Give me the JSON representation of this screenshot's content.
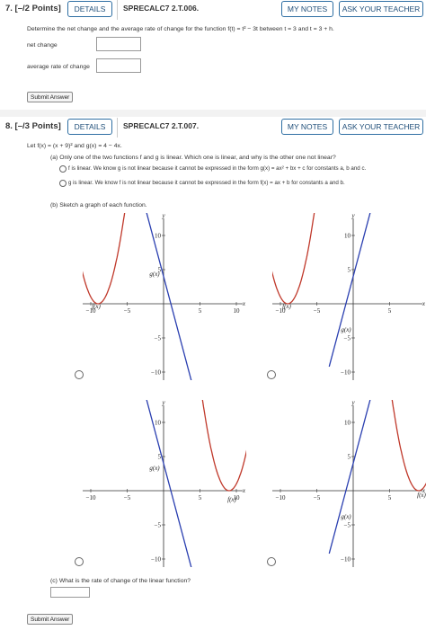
{
  "q7": {
    "number": "7. [–/2 Points]",
    "details": "DETAILS",
    "code": "SPRECALC7 2.T.006.",
    "my_notes": "MY NOTES",
    "ask": "ASK YOUR TEACHER",
    "prompt": "Determine the net change and the average rate of change for the function f(t) = t² − 3t between t = 3 and t = 3 + h.",
    "net_change_label": "net change",
    "avg_rate_label": "average rate of change",
    "submit": "Submit Answer"
  },
  "q8": {
    "number": "8. [–/3 Points]",
    "details": "DETAILS",
    "code": "SPRECALC7 2.T.007.",
    "my_notes": "MY NOTES",
    "ask": "ASK YOUR TEACHER",
    "let": "Let f(x) = (x + 9)² and g(x) = 4 − 4x.",
    "part_a": "(a) Only one of the two functions f and g is linear. Which one is linear, and why is the other one not linear?",
    "option1": "f is linear. We know g is not linear because it cannot be expressed in the form g(x) = ax² + bx + c for constants a, b and c.",
    "option2": "g is linear. We know f is not linear because it cannot be expressed in the form f(x) = ax + b for constants a and b.",
    "part_b": "(b) Sketch a graph of each function.",
    "part_c": "(c) What is the rate of change of the linear function?",
    "submit": "Submit Answer",
    "graph_labels": {
      "x": "x",
      "y": "y",
      "x_ticks": [
        "−10",
        "−5",
        "5",
        "10"
      ],
      "y_ticks": [
        "10",
        "5",
        "−5",
        "−10"
      ],
      "f": "f(x)",
      "g": "g(x)"
    }
  },
  "colors": {
    "accent": "#2f6fa3",
    "f_curve": "#c0392b",
    "g_line": "#2a3fb0"
  }
}
